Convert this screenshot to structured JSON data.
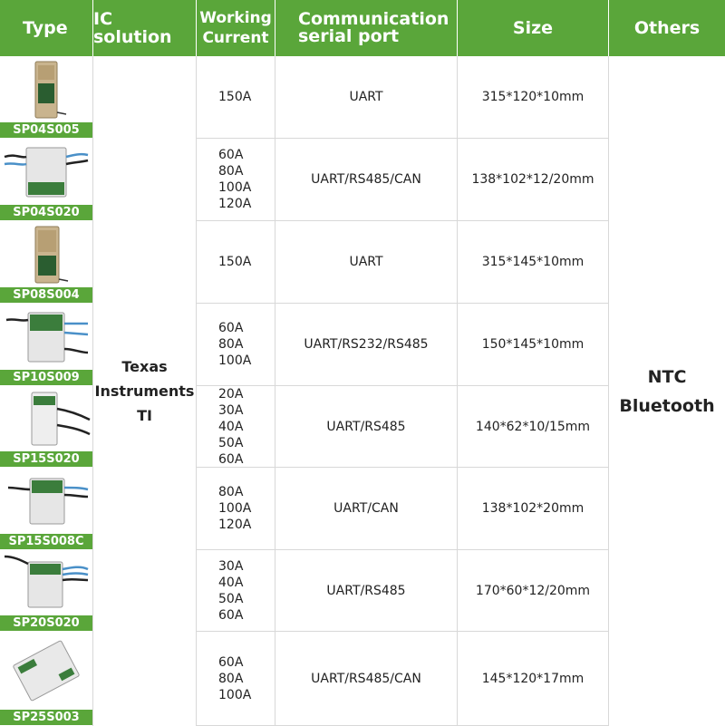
{
  "headers": {
    "type": "Type",
    "ic": "IC solution",
    "current_line1": "Working",
    "current_line2": "Current",
    "comm_line1": "Communication",
    "comm_line2": "serial port",
    "size": "Size",
    "others": "Others"
  },
  "ic_solution": [
    "Texas",
    "Instruments",
    "TI"
  ],
  "others": [
    "NTC",
    "Bluetooth"
  ],
  "rows": [
    {
      "type": "SP04S005",
      "currents": [
        "150A"
      ],
      "port": "UART",
      "size": "315*120*10mm"
    },
    {
      "type": "SP04S020",
      "currents": [
        "60A",
        "80A",
        "100A",
        "120A"
      ],
      "port": "UART/RS485/CAN",
      "size": "138*102*12/20mm"
    },
    {
      "type": "SP08S004",
      "currents": [
        "150A"
      ],
      "port": "UART",
      "size": "315*145*10mm"
    },
    {
      "type": "SP10S009",
      "currents": [
        "60A",
        "80A",
        "100A"
      ],
      "port": "UART/RS232/RS485",
      "size": "150*145*10mm"
    },
    {
      "type": "SP15S020",
      "currents": [
        "20A",
        "30A",
        "40A",
        "50A",
        "60A"
      ],
      "port": "UART/RS485",
      "size": "140*62*10/15mm"
    },
    {
      "type": "SP15S008C",
      "currents": [
        "80A",
        "100A",
        "120A"
      ],
      "port": "UART/CAN",
      "size": "138*102*20mm"
    },
    {
      "type": "SP20S020",
      "currents": [
        "30A",
        "40A",
        "50A",
        "60A"
      ],
      "port": "UART/RS485",
      "size": "170*60*12/20mm"
    },
    {
      "type": "SP25S003",
      "currents": [
        "60A",
        "80A",
        "100A"
      ],
      "port": "UART/RS485/CAN",
      "size": "145*120*17mm"
    }
  ]
}
